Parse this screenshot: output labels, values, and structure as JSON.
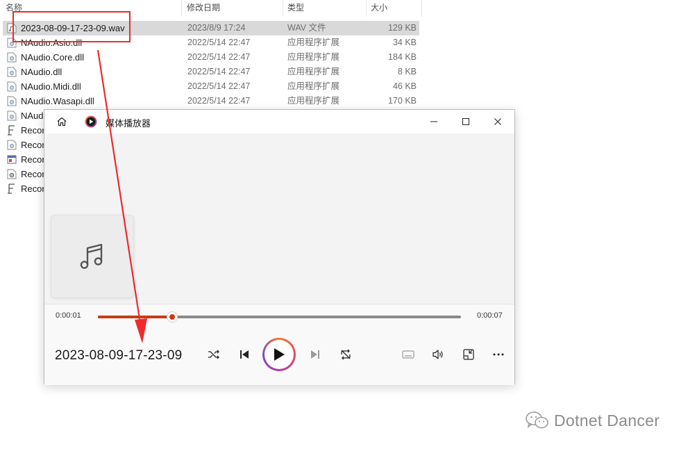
{
  "explorer": {
    "columns": {
      "name": "名称",
      "date": "修改日期",
      "type": "类型",
      "size": "大小"
    },
    "files": [
      {
        "name": "2023-08-09-17-23-09.wav",
        "date": "2023/8/9 17:24",
        "type": "WAV 文件",
        "size": "129 KB",
        "icon": "audio-file-icon",
        "selected": true
      },
      {
        "name": "NAudio.Asio.dll",
        "date": "2022/5/14 22:47",
        "type": "应用程序扩展",
        "size": "34 KB",
        "icon": "dll-file-icon"
      },
      {
        "name": "NAudio.Core.dll",
        "date": "2022/5/14 22:47",
        "type": "应用程序扩展",
        "size": "184 KB",
        "icon": "dll-file-icon"
      },
      {
        "name": "NAudio.dll",
        "date": "2022/5/14 22:47",
        "type": "应用程序扩展",
        "size": "8 KB",
        "icon": "dll-file-icon"
      },
      {
        "name": "NAudio.Midi.dll",
        "date": "2022/5/14 22:47",
        "type": "应用程序扩展",
        "size": "46 KB",
        "icon": "dll-file-icon"
      },
      {
        "name": "NAudio.Wasapi.dll",
        "date": "2022/5/14 22:47",
        "type": "应用程序扩展",
        "size": "170 KB",
        "icon": "dll-file-icon"
      },
      {
        "name": "NAud",
        "date": "",
        "type": "",
        "size": "",
        "icon": "dll-file-icon"
      },
      {
        "name": "Recor",
        "date": "",
        "type": "",
        "size": "",
        "icon": "json-file-icon"
      },
      {
        "name": "Recor",
        "date": "",
        "type": "",
        "size": "",
        "icon": "dll-file-icon"
      },
      {
        "name": "Recor",
        "date": "",
        "type": "",
        "size": "",
        "icon": "exe-file-icon"
      },
      {
        "name": "Recor",
        "date": "",
        "type": "",
        "size": "",
        "icon": "config-file-icon"
      },
      {
        "name": "Recor",
        "date": "",
        "type": "",
        "size": "",
        "icon": "json-file-icon"
      }
    ]
  },
  "player": {
    "app_title": "媒体播放器",
    "current_time": "0:00:01",
    "total_time": "0:00:07",
    "progress": 0.205,
    "song_title": "2023-08-09-17-23-09"
  },
  "watermark": {
    "text": "Dotnet Dancer"
  },
  "colors": {
    "annotation_red": "#ee2a2a",
    "accent": "#c83c14"
  }
}
